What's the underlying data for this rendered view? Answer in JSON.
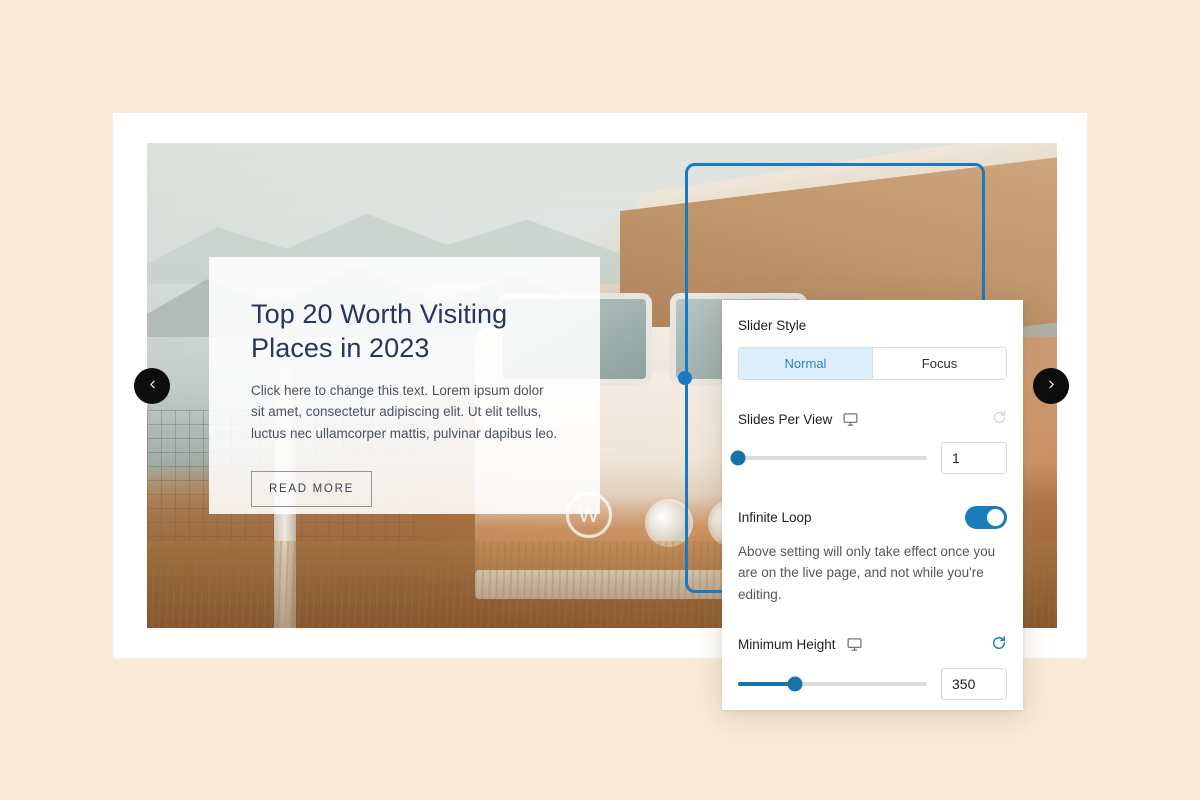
{
  "background_color": "#faeada",
  "canvas": {
    "background": "#ffffff"
  },
  "slide": {
    "heading": "Top 20 Worth Visiting Places in 2023",
    "body": "Click here to change this text. Lorem ipsum dolor sit amet, consectetur adipiscing elit. Ut elit tellus, luctus nec ullamcorper mattis, pulvinar dapibus leo.",
    "cta_label": "READ MORE",
    "heading_color": "#27355f"
  },
  "nav": {
    "prev_icon": "chevron-left-icon",
    "next_icon": "chevron-right-icon"
  },
  "panel": {
    "slider_style": {
      "label": "Slider Style",
      "options": [
        "Normal",
        "Focus"
      ],
      "selected": "Normal",
      "active_bg": "#deeffc",
      "active_text": "#2a7fc4"
    },
    "slides_per_view": {
      "label": "Slides Per View",
      "device_icon": "desktop-monitor-icon",
      "reset_icon": "reset-icon",
      "reset_enabled": false,
      "value": "1",
      "min": 1,
      "max": 6,
      "percent": 0
    },
    "infinite_loop": {
      "label": "Infinite Loop",
      "enabled": true,
      "toggle_color": "#1a7cb8",
      "help_text": "Above setting will only take effect once you are on the live page, and not while you're editing."
    },
    "minimum_height": {
      "label": "Minimum Height",
      "device_icon": "desktop-monitor-icon",
      "reset_icon": "reset-icon",
      "reset_enabled": true,
      "reset_color": "#1a7cb8",
      "value": "350",
      "min": 0,
      "max": 1000,
      "percent": 30
    }
  }
}
